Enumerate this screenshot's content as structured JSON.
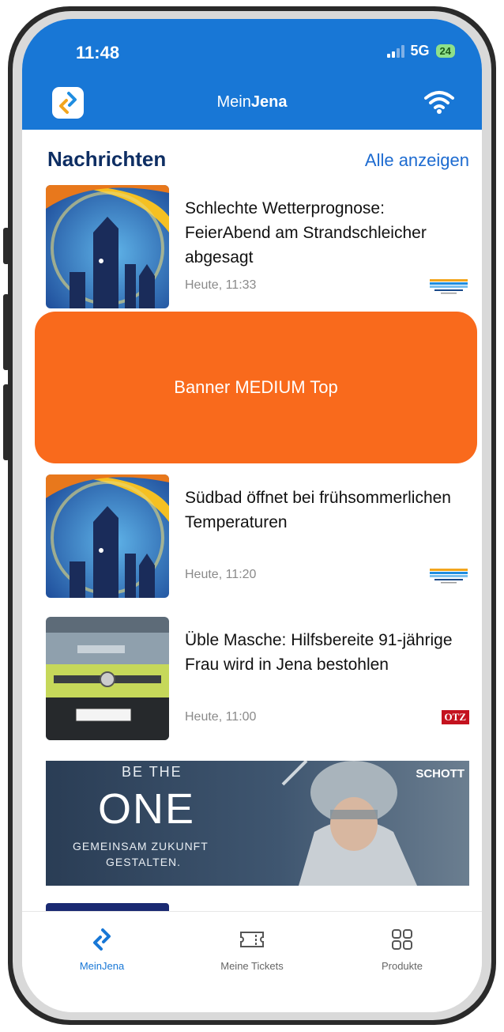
{
  "status_bar": {
    "time": "11:48",
    "network": "5G",
    "battery": "24"
  },
  "header": {
    "title_prefix": "Mein",
    "title_bold": "Jena"
  },
  "news": {
    "section_title": "Nachrichten",
    "show_all": "Alle anzeigen",
    "items": [
      {
        "title": "Schlechte Wetterprognose: FeierAbend am Strandschleicher abgesagt",
        "time": "Heute, 11:33",
        "source": "stadtwerke-jena-logo"
      },
      {
        "title": "Südbad öffnet bei frühsommerlichen Temperaturen",
        "time": "Heute, 11:20",
        "source": "stadtwerke-jena-logo"
      },
      {
        "title": "Üble Masche: Hilfsbereite 91-jährige Frau wird in Jena bestohlen",
        "time": "Heute, 11:00",
        "source": "OTZ"
      }
    ]
  },
  "banner_medium": {
    "label": "Banner MEDIUM Top"
  },
  "ad": {
    "line1": "BE THE",
    "line2": "ONE",
    "line3": "GEMEINSAM ZUKUNFT",
    "line4": "GESTALTEN.",
    "brand": "SCHOTT"
  },
  "tabbar": {
    "items": [
      {
        "label": "MeinJena",
        "icon": "meinjena-logo-icon",
        "active": true
      },
      {
        "label": "Meine Tickets",
        "icon": "ticket-icon",
        "active": false
      },
      {
        "label": "Produkte",
        "icon": "grid-icon",
        "active": false
      }
    ]
  },
  "colors": {
    "brand_blue": "#1877d6",
    "banner_orange": "#f96a1c",
    "title_navy": "#0e2e63",
    "link_blue": "#1d6bd0"
  }
}
